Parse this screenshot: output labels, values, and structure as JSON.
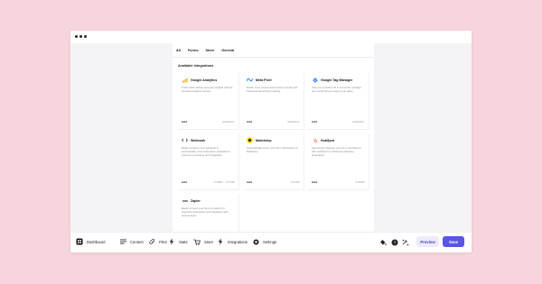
{
  "tabs": [
    "All",
    "Forms",
    "Store",
    "General"
  ],
  "section_title": "Available integrations",
  "cards": [
    {
      "name": "Google Analytics",
      "desc": "Track visitor activity and gain insights with the standard analytics service.",
      "add": "Add",
      "tag": "GENERAL",
      "logo": "bar-chart-icon",
      "logo_color": "#f4b400"
    },
    {
      "name": "Meta Pixel",
      "desc": "Reach more people and measure results with Facebook advertising tracking.",
      "add": "Add",
      "tag": "GENERAL",
      "logo": "meta-icon",
      "logo_color": "#1877f2"
    },
    {
      "name": "Google Tag Manager",
      "desc": "Add your container ID to set up the manager and control all your tags in one place.",
      "add": "Add",
      "tag": "GENERAL",
      "logo": "tag-diamond-icon",
      "logo_color": "#4285f4"
    },
    {
      "name": "Webhook",
      "desc": "Easily configure your webhook to automatically send submission payloads for real-time processing and integration.",
      "add": "Add",
      "tag": "FORMS · STORE",
      "logo": "code-icon",
      "logo_color": "#222222"
    },
    {
      "name": "Mailchimp",
      "desc": "Automatically export your form submissions to Mailchimp.",
      "add": "Add",
      "tag": "FORMS",
      "logo": "mailchimp-icon",
      "logo_color": "#ffe01b"
    },
    {
      "name": "HubSpot",
      "desc": "Seamlessly integrate your form submissions with HubSpot for enhanced marketing automation.",
      "add": "Add",
      "tag": "FORMS",
      "logo": "hubspot-icon",
      "logo_color": "#ff7a59"
    },
    {
      "name": "Zapier",
      "desc": "Easily connect your forms to Zapier for seamless automation and integration with various apps.",
      "add": "Add",
      "tag": "FORMS",
      "logo": "zapier-icon",
      "logo_color": "#222222"
    }
  ],
  "toolbar": {
    "items": [
      "Dashboard",
      "Content",
      "Files",
      "Stats",
      "Store",
      "Integrations",
      "Settings"
    ],
    "preview_label": "Preview",
    "save_label": "Save"
  },
  "colors": {
    "accent": "#5b54e8",
    "background": "#f6d5dc"
  }
}
